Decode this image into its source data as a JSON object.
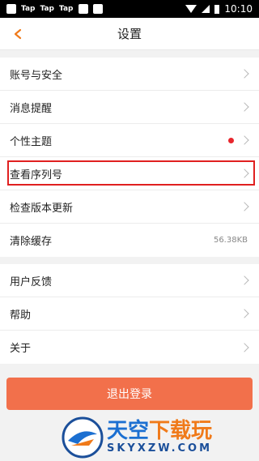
{
  "status_bar": {
    "apps": [
      "Tap",
      "Tap",
      "Tap"
    ],
    "time": "10:10"
  },
  "nav": {
    "title": "设置"
  },
  "groups": [
    {
      "items": [
        {
          "label": "账号与安全"
        },
        {
          "label": "消息提醒"
        },
        {
          "label": "个性主题",
          "badge": "red-dot"
        },
        {
          "label": "查看序列号",
          "highlighted": true
        },
        {
          "label": "检查版本更新"
        },
        {
          "label": "清除缓存",
          "value": "56.38KB"
        }
      ]
    },
    {
      "items": [
        {
          "label": "用户反馈"
        },
        {
          "label": "帮助"
        },
        {
          "label": "关于"
        }
      ]
    }
  ],
  "logout_button": "退出登录",
  "watermark": {
    "main_blue": "天空",
    "main_orange": "下载玩",
    "sub": "SKYXZW.COM"
  },
  "colors": {
    "accent": "#f2704b",
    "back_arrow": "#f07a1a",
    "highlight_border": "#e02020",
    "badge_dot": "#e8262d"
  }
}
